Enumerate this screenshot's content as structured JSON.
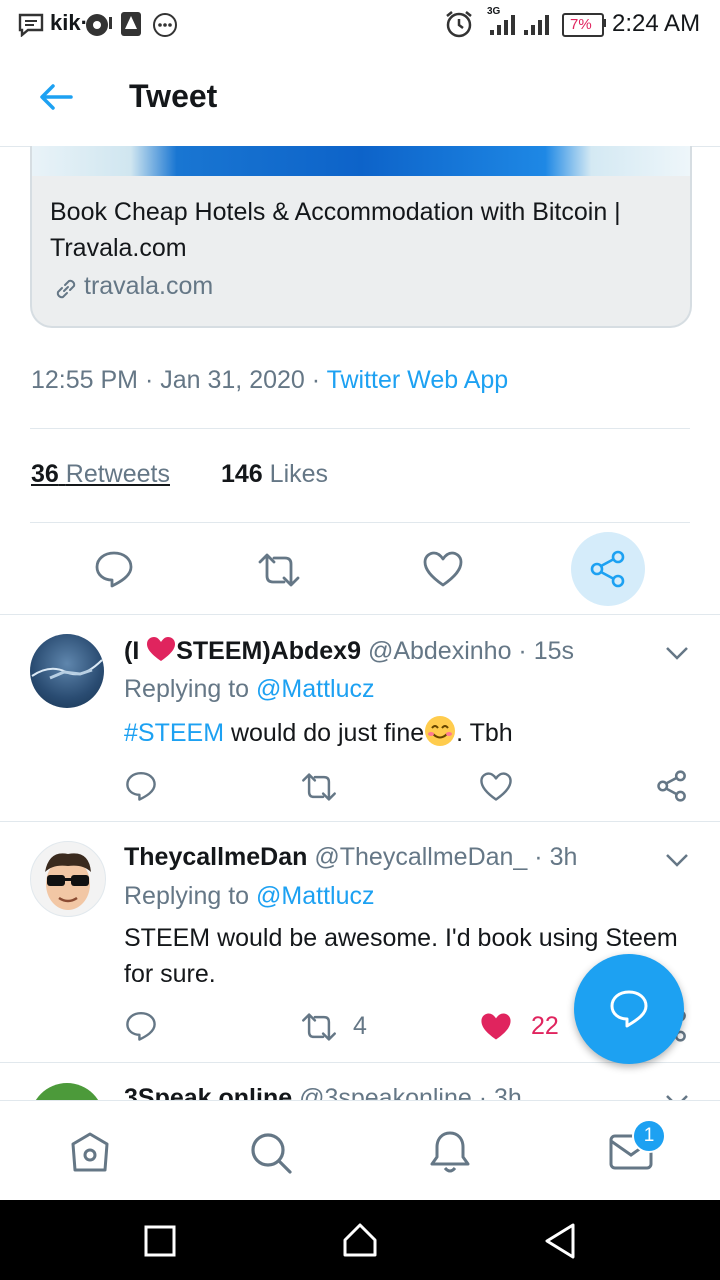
{
  "status_bar": {
    "kik_label": "kik·",
    "battery": "7%",
    "time": "2:24 AM",
    "network": "3G"
  },
  "header": {
    "title": "Tweet"
  },
  "link_card": {
    "title": "Book Cheap Hotels & Accommodation with Bitcoin | Travala.com",
    "domain": "travala.com"
  },
  "tweet_meta": {
    "time": "12:55 PM",
    "date": "Jan 31, 2020",
    "source": "Twitter Web App"
  },
  "stats": {
    "retweets_count": "36",
    "retweets_label": "Retweets",
    "likes_count": "146",
    "likes_label": "Likes"
  },
  "replies": [
    {
      "name_prefix": "(I ",
      "name_suffix": "STEEM)Abdex9",
      "handle": "@Abdexinho",
      "time": "15s",
      "replying_label": "Replying to",
      "replying_to": "@Mattlucz",
      "hashtag": "#STEEM",
      "text_after_hashtag": " would do just fine",
      "text_end": ". Tbh"
    },
    {
      "name": "TheycallmeDan",
      "handle": "@TheycallmeDan_",
      "time": "3h",
      "replying_label": "Replying to",
      "replying_to": "@Mattlucz",
      "text": "STEEM would be awesome. I'd book using Steem for sure.",
      "retweets": "4",
      "likes": "22"
    },
    {
      "name": "3Speak.online",
      "handle": "@3speakonline",
      "time": "3h"
    }
  ],
  "bottom_nav": {
    "messages_badge": "1"
  },
  "colors": {
    "accent": "#1da1f2",
    "like": "#e0245e",
    "muted": "#657786"
  }
}
